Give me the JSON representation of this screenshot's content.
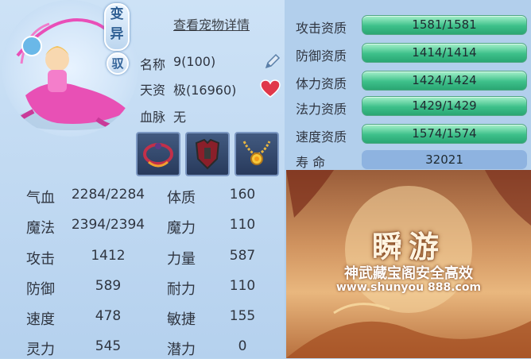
{
  "pet": {
    "mutate_badge": "变异",
    "ride_badge": "驭",
    "detail_link": "查看宠物详情",
    "name_label": "名称",
    "name_value": "9(100)",
    "talent_label": "天资",
    "talent_value": "极(16960)",
    "bloodline_label": "血脉",
    "bloodline_value": "无"
  },
  "equipment": [
    "ring-icon",
    "armor-icon",
    "necklace-icon"
  ],
  "stats": [
    {
      "label": "气血",
      "value": "2284/2284",
      "label2": "体质",
      "value2": "160"
    },
    {
      "label": "魔法",
      "value": "2394/2394",
      "label2": "魔力",
      "value2": "110"
    },
    {
      "label": "攻击",
      "value": "1412",
      "label2": "力量",
      "value2": "587"
    },
    {
      "label": "防御",
      "value": "589",
      "label2": "耐力",
      "value2": "110"
    },
    {
      "label": "速度",
      "value": "478",
      "label2": "敏捷",
      "value2": "155"
    },
    {
      "label": "灵力",
      "value": "545",
      "label2": "潜力",
      "value2": "0"
    }
  ],
  "aptitudes": [
    {
      "label": "攻击资质",
      "value": "1581/1581"
    },
    {
      "label": "防御资质",
      "value": "1414/1414"
    },
    {
      "label": "体力资质",
      "value": "1424/1424"
    },
    {
      "label": "法力资质",
      "value": "1429/1429"
    },
    {
      "label": "速度资质",
      "value": "1574/1574"
    }
  ],
  "life": {
    "label": "寿    命",
    "value": "32021"
  },
  "ad": {
    "title": "瞬游",
    "slogan": "神武藏宝阁安全高效",
    "url": "www.shunyou 888.com"
  },
  "colors": {
    "aptitude_bar": "#3dc08a",
    "life_bar": "#8eb3e0",
    "heart": "#e0384a"
  }
}
